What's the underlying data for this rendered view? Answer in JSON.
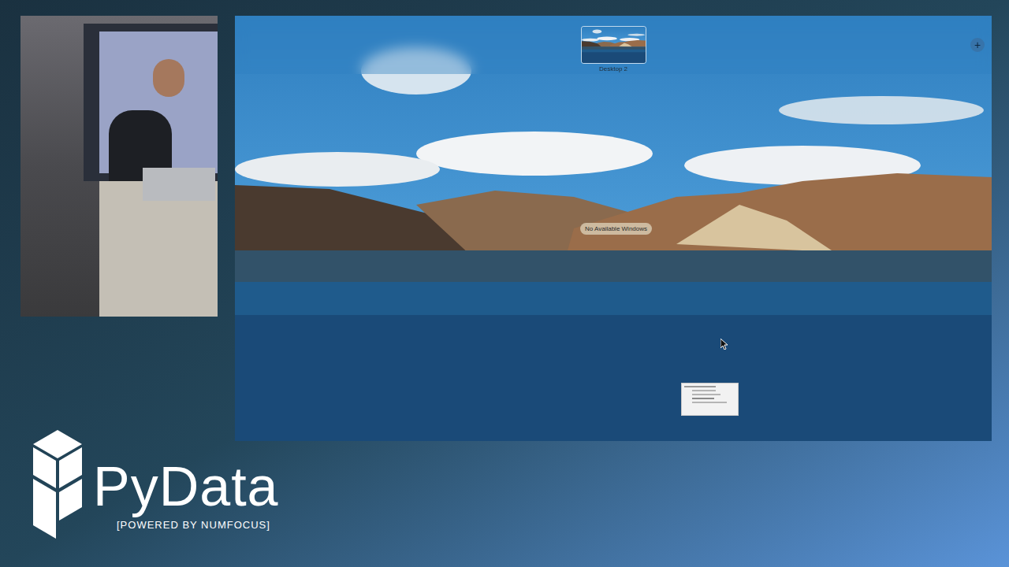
{
  "spaces_bar": {
    "desktops": [
      {
        "label": "Desktop 2",
        "selected": true
      }
    ],
    "add_button": "+"
  },
  "desktop": {
    "message": "No Available Windows"
  },
  "branding": {
    "name": "PyData",
    "tagline": "[POWERED BY NUMFOCUS]"
  }
}
